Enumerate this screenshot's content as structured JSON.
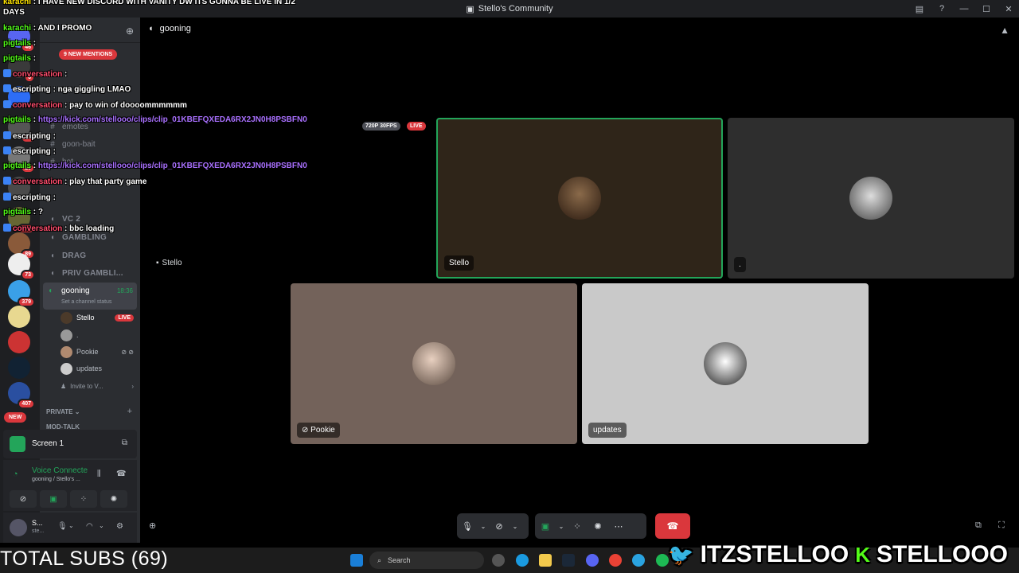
{
  "window": {
    "title": "Stello's Community"
  },
  "server_badges": [
    "46",
    "6",
    "27",
    "20",
    "618",
    "89",
    "73",
    "379",
    "407"
  ],
  "new_label": "NEW",
  "mentions_label": "9 NEW MENTIONS",
  "channels": [
    {
      "name": "emotes",
      "style": "text"
    },
    {
      "name": "goon-bait",
      "style": "text"
    },
    {
      "name": "bot",
      "style": "text"
    },
    {
      "name": "VC 2",
      "style": "voice-upper"
    },
    {
      "name": "GAMBLING",
      "style": "voice-upper"
    },
    {
      "name": "DRAG",
      "style": "voice-upper"
    },
    {
      "name": "PRIV GAMBLI...",
      "style": "voice-upper"
    }
  ],
  "active_channel": {
    "name": "gooning",
    "time": "18:36",
    "status": "Set a channel status"
  },
  "voice_users": [
    {
      "name": "Stello",
      "live": "LIVE"
    },
    {
      "name": ".",
      "live": ""
    },
    {
      "name": "Pookie",
      "live": ""
    },
    {
      "name": "updates",
      "live": ""
    }
  ],
  "invite_label": "Invite to V...",
  "private_label": "PRIVATE",
  "mod_talk": "MOD-TALK",
  "screen_panel": {
    "label": "Screen 1"
  },
  "voice_panel": {
    "status": "Voice Connecte",
    "sub": "gooning / Stello's ..."
  },
  "user_panel": {
    "name": "S...",
    "status": "ste..."
  },
  "stage": {
    "channel": "gooning",
    "stream_owner": "Stello",
    "fps_badge": "720P 30FPS",
    "live_badge": "LIVE"
  },
  "tiles": [
    {
      "name": "Stello",
      "bg": "#2f2519",
      "border": "#23a55a"
    },
    {
      "name": ".",
      "bg": "#2e2e2e",
      "border": ""
    },
    {
      "name": "Pookie",
      "bg": "#73625a",
      "border": ""
    },
    {
      "name": "updates",
      "bg": "#c9c9c9",
      "border": ""
    }
  ],
  "taskbar": {
    "search": "Search"
  },
  "overlay": {
    "total_subs": "TOTAL SUBS (69)",
    "twitter": "ITZSTELLOO",
    "kick": "STELLOOO"
  },
  "chat": [
    {
      "user": "karachi",
      "color": "#ffe400",
      "text": " : I HAVE NEW DISCORD WITH VANITY DW ITS GONNA BE LIVE IN 1/2",
      "icon": false
    },
    {
      "user": "",
      "color": "#fff",
      "text": "DAYS",
      "icon": false
    },
    {
      "user": "karachi",
      "color": "#53fc18",
      "text": " : AND I PROMO",
      "icon": false
    },
    {
      "user": "pigtails",
      "color": "#53fc18",
      "text": " : ",
      "icon": false
    },
    {
      "user": "pigtails",
      "color": "#53fc18",
      "text": " : ",
      "icon": false
    },
    {
      "user": "conversation",
      "color": "#ff4d6d",
      "text": " : ",
      "icon": true
    },
    {
      "user": "escripting",
      "color": "#ffffff",
      "text": " : nga giggling LMAO",
      "icon": true
    },
    {
      "user": "conversation",
      "color": "#ff4d6d",
      "text": " : pay to win of doooommmmmm",
      "icon": true
    },
    {
      "user": "pigtails",
      "color": "#53fc18",
      "text": " : ",
      "link": "https://kick.com/stellooo/clips/clip_01KBEFQXEDA6RX2JN0H8PSBFN0",
      "icon": false
    },
    {
      "user": "escripting",
      "color": "#ffffff",
      "text": " : ",
      "icon": true
    },
    {
      "user": "escripting",
      "color": "#ffffff",
      "text": " : ",
      "icon": true
    },
    {
      "user": "pigtails",
      "color": "#53fc18",
      "text": " : ",
      "link": "https://kick.com/stellooo/clips/clip_01KBEFQXEDA6RX2JN0H8PSBFN0",
      "icon": false
    },
    {
      "user": "conversation",
      "color": "#ff4d6d",
      "text": " : play that party game",
      "icon": true
    },
    {
      "user": "escripting",
      "color": "#ffffff",
      "text": " : ",
      "icon": true
    },
    {
      "user": "pigtails",
      "color": "#53fc18",
      "text": " : ?",
      "icon": false
    },
    {
      "user": "conversation",
      "color": "#ff4d6d",
      "text": " : bbc loading",
      "icon": true
    }
  ]
}
